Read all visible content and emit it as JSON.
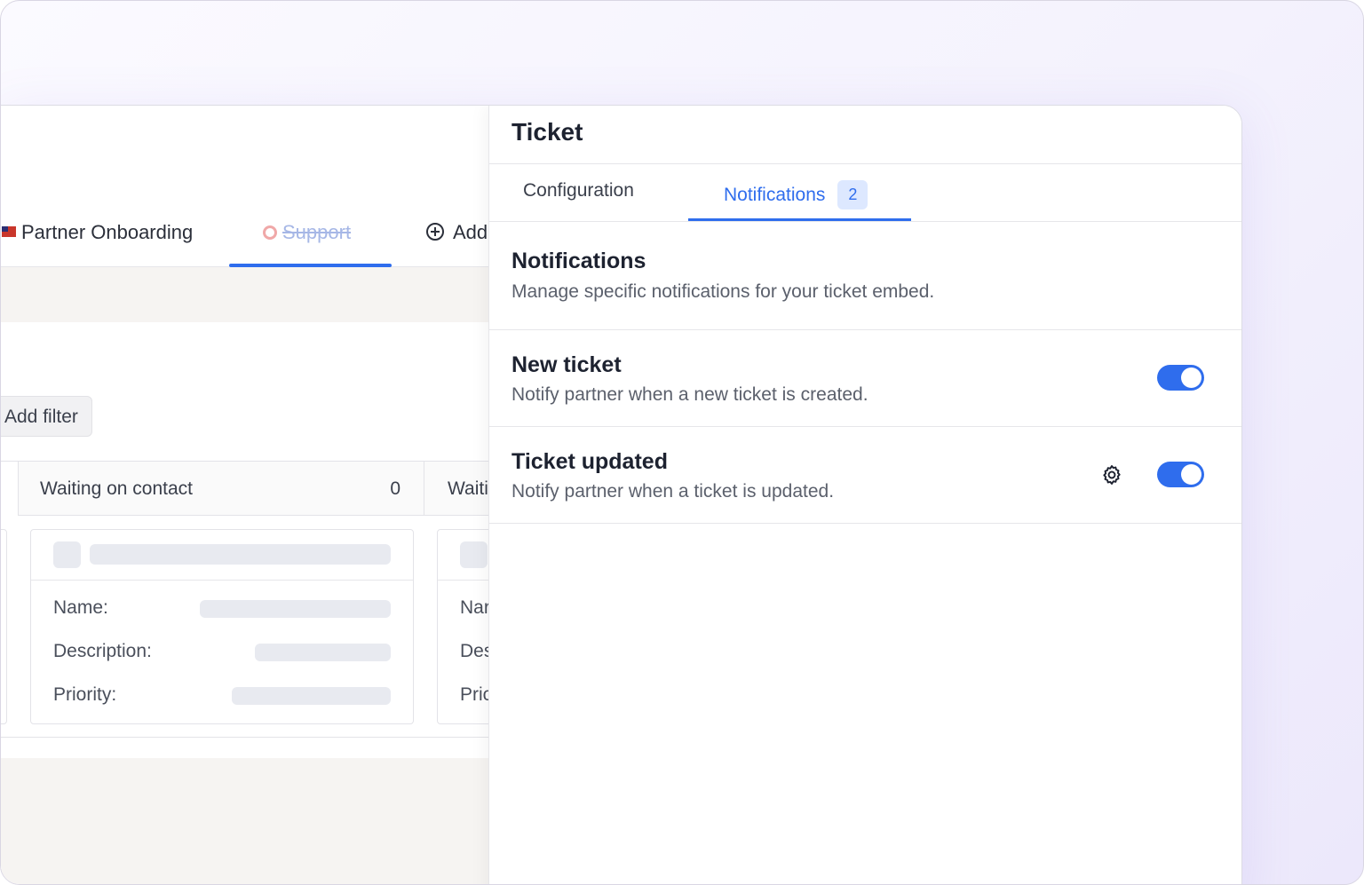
{
  "board": {
    "tabs": [
      {
        "label": "Partner Onboarding"
      },
      {
        "label": "Support"
      },
      {
        "label": "Add"
      }
    ],
    "add_filter_label": "Add filter",
    "columns": [
      {
        "title": "Waiting on contact",
        "count": "0"
      },
      {
        "title": "Waiting"
      }
    ],
    "card_fields": [
      "Name:",
      "Description:",
      "Priority:"
    ],
    "card_fields_clipped": [
      "Nar",
      "Des",
      "Pric"
    ]
  },
  "panel": {
    "title": "Ticket",
    "tabs": [
      {
        "label": "Configuration"
      },
      {
        "label": "Notifications",
        "badge": "2",
        "active": true
      }
    ],
    "intro": {
      "heading": "Notifications",
      "description": "Manage specific notifications for your ticket embed."
    },
    "items": [
      {
        "title": "New ticket",
        "description": "Notify partner when a new ticket is created.",
        "enabled": true
      },
      {
        "title": "Ticket updated",
        "description": "Notify partner when a ticket is updated.",
        "enabled": true,
        "settings_icon": "gear-icon"
      }
    ]
  },
  "colors": {
    "accent": "#2f6ded",
    "badge_bg": "#dde8ff",
    "text_primary": "#1d2230",
    "text_secondary": "#5b606c"
  }
}
